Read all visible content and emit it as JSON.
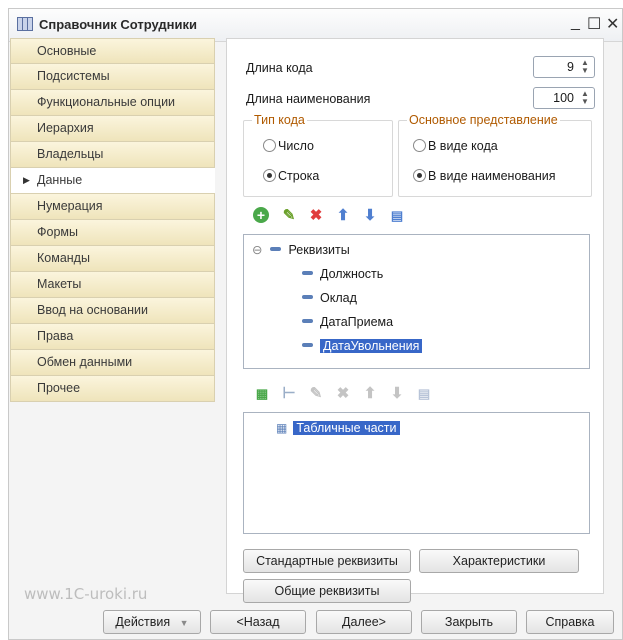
{
  "window": {
    "title": "Справочник Сотрудники",
    "minimize": "_",
    "maximize": "☐",
    "close": "✕"
  },
  "sidebar": {
    "items": [
      {
        "label": "Основные"
      },
      {
        "label": "Подсистемы"
      },
      {
        "label": "Функциональные опции"
      },
      {
        "label": "Иерархия"
      },
      {
        "label": "Владельцы"
      },
      {
        "label": "Данные",
        "active": true
      },
      {
        "label": "Нумерация"
      },
      {
        "label": "Формы"
      },
      {
        "label": "Команды"
      },
      {
        "label": "Макеты"
      },
      {
        "label": "Ввод на основании"
      },
      {
        "label": "Права"
      },
      {
        "label": "Обмен данными"
      },
      {
        "label": "Прочее"
      }
    ]
  },
  "main": {
    "code_length_label": "Длина кода",
    "code_length_value": "9",
    "name_length_label": "Длина наименования",
    "name_length_value": "100",
    "code_type": {
      "legend": "Тип кода",
      "option_number": "Число",
      "option_string": "Строка",
      "selected": "Строка"
    },
    "main_presentation": {
      "legend": "Основное представление",
      "option_code": "В виде кода",
      "option_name": "В виде наименования",
      "selected": "В виде наименования"
    },
    "attributes_tree": {
      "root": "Реквизиты",
      "items": [
        "Должность",
        "Оклад",
        "ДатаПриема",
        "ДатаУвольнения"
      ],
      "selected": "ДатаУвольнения"
    },
    "tabular_tree": {
      "root": "Табличные части"
    },
    "buttons": {
      "standard_attributes": "Стандартные реквизиты",
      "characteristics": "Характеристики",
      "common_attributes": "Общие реквизиты"
    }
  },
  "watermark": "www.1C-uroki.ru",
  "footer": {
    "actions": "Действия",
    "back": "<Назад",
    "next": "Далее>",
    "close": "Закрыть",
    "help": "Справка"
  },
  "colors": {
    "sidebar_tab": "#efe4bb",
    "selection": "#3867c8",
    "legend": "#b05a00",
    "add_icon": "#4aa84a",
    "delete_icon": "#e03c3c",
    "arrow_icon": "#4f7fd0"
  }
}
